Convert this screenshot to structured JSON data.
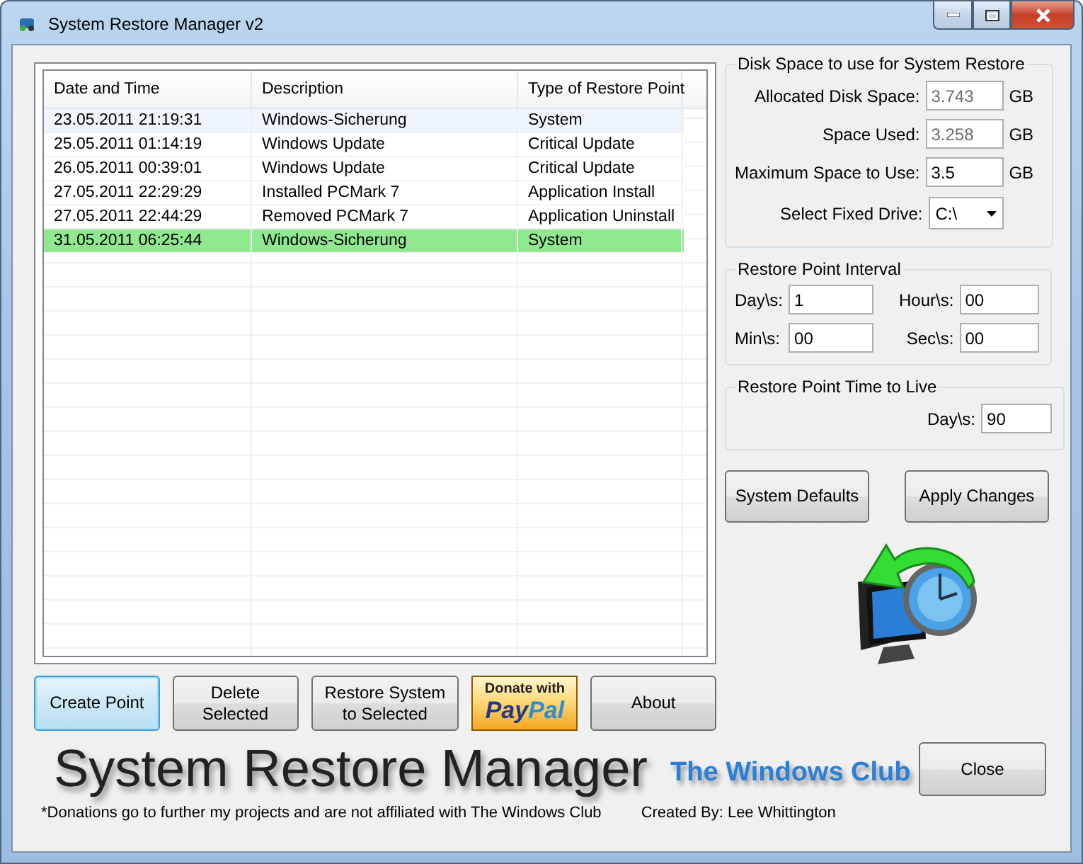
{
  "window": {
    "title": "System Restore Manager v2"
  },
  "table": {
    "columns": [
      "Date and Time",
      "Description",
      "Type of Restore Point"
    ],
    "rows": [
      {
        "cells": [
          "23.05.2011 21:19:31",
          "Windows-Sicherung",
          "System"
        ],
        "selected": false,
        "hovered": true
      },
      {
        "cells": [
          "25.05.2011 01:14:19",
          "Windows Update",
          "Critical Update"
        ],
        "selected": false,
        "hovered": false
      },
      {
        "cells": [
          "26.05.2011 00:39:01",
          "Windows Update",
          "Critical Update"
        ],
        "selected": false,
        "hovered": false
      },
      {
        "cells": [
          "27.05.2011 22:29:29",
          "Installed PCMark 7",
          "Application Install"
        ],
        "selected": false,
        "hovered": false
      },
      {
        "cells": [
          "27.05.2011 22:44:29",
          "Removed PCMark 7",
          "Application Uninstall"
        ],
        "selected": false,
        "hovered": false
      },
      {
        "cells": [
          "31.05.2011 06:25:44",
          "Windows-Sicherung",
          "System"
        ],
        "selected": true,
        "hovered": false
      }
    ]
  },
  "disk_space": {
    "title": "Disk Space to use for System Restore",
    "fields": [
      {
        "kind": "readonly",
        "label": "Allocated Disk Space:",
        "value": "3.743",
        "unit": "GB"
      },
      {
        "kind": "readonly",
        "label": "Space Used:",
        "value": "3.258",
        "unit": "GB"
      },
      {
        "kind": "input",
        "label": "Maximum Space to Use:",
        "value": "3.5",
        "unit": "GB"
      },
      {
        "kind": "dropdown",
        "label": "Select Fixed Drive:",
        "value": "C:\\"
      }
    ]
  },
  "interval": {
    "title": "Restore Point Interval",
    "fields": [
      {
        "label": "Day\\s:",
        "value": "1"
      },
      {
        "label": "Hour\\s:",
        "value": "00"
      },
      {
        "label": "Min\\s:",
        "value": "00"
      },
      {
        "label": "Sec\\s:",
        "value": "00"
      }
    ]
  },
  "time_to_live": {
    "title": "Restore Point Time to Live",
    "label": "Day\\s:",
    "value": "90"
  },
  "settings_buttons": [
    "System Defaults",
    "Apply Changes"
  ],
  "action_buttons": [
    {
      "kind": "button",
      "label": "Create Point",
      "focused": true
    },
    {
      "kind": "button",
      "label": "Delete Selected",
      "focused": false
    },
    {
      "kind": "button",
      "label": "Restore System to Selected",
      "focused": false
    },
    {
      "kind": "paypal",
      "top": "Donate with",
      "brand_1": "Pay",
      "brand_2": "Pal"
    },
    {
      "kind": "button",
      "label": "About",
      "focused": false
    }
  ],
  "banner": {
    "title": "System Restore Manager",
    "club": "The Windows Club"
  },
  "close_button": "Close",
  "footer": {
    "note": "*Donations go to further my projects and are not affiliated with The Windows Club",
    "credit": "Created By: Lee Whittington"
  }
}
